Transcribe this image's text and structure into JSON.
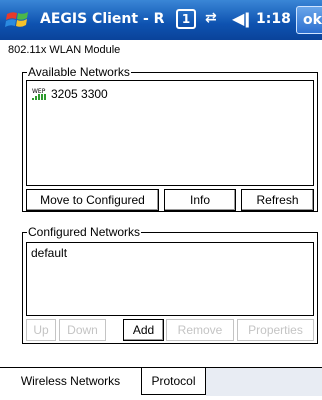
{
  "titlebar": {
    "title": "AEGIS Client - R",
    "status_box": "1",
    "time": "1:18",
    "ok_label": "ok"
  },
  "module_label": "802.11x WLAN Module",
  "available": {
    "title": "Available Networks",
    "networks": [
      {
        "ssid": "3205 3300",
        "security": "WEP"
      }
    ],
    "buttons": {
      "move": "Move to Configured",
      "info": "Info",
      "refresh": "Refresh"
    }
  },
  "configured": {
    "title": "Configured Networks",
    "networks": [
      "default"
    ],
    "buttons": {
      "up": "Up",
      "down": "Down",
      "add": "Add",
      "remove": "Remove",
      "properties": "Properties"
    }
  },
  "tabs": [
    {
      "label": "Wireless Networks",
      "active": true
    },
    {
      "label": "Protocol",
      "active": false
    }
  ]
}
